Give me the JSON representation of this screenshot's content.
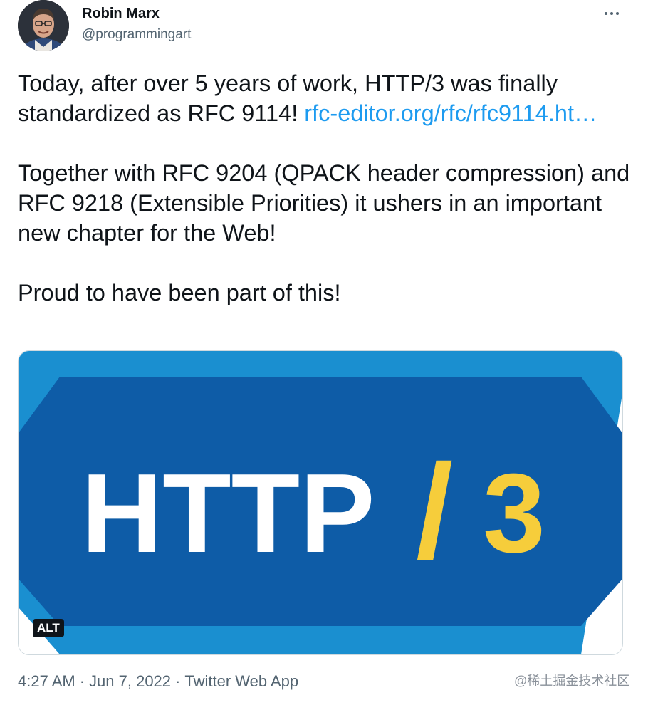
{
  "tweet": {
    "author": {
      "name": "Robin Marx",
      "handle": "@programmingart"
    },
    "paragraphs": [
      {
        "text": "Today, after over 5 years of work, HTTP/3 was finally standardized as RFC 9114! ",
        "link": "rfc-editor.org/rfc/rfc9114.ht…"
      },
      {
        "text": "Together with RFC 9204 (QPACK header compression) and RFC 9218 (Extensible Priorities) it ushers in an important new chapter for the Web!"
      },
      {
        "text": "Proud to have been part of this!"
      }
    ],
    "media": {
      "logo_text": "HTTP",
      "logo_slash": "/",
      "logo_number": "3",
      "alt_label": "ALT",
      "colors": {
        "outer_blue": "#1a8fd0",
        "inner_blue": "#0e5ca7",
        "white": "#ffffff",
        "yellow": "#f6cd3b"
      }
    },
    "meta": {
      "time": "4:27 AM",
      "separator": "·",
      "date": "Jun 7, 2022",
      "source": "Twitter Web App"
    }
  },
  "watermark": "@稀土掘金技术社区",
  "icons": {
    "more": "more-horizontal-icon"
  }
}
